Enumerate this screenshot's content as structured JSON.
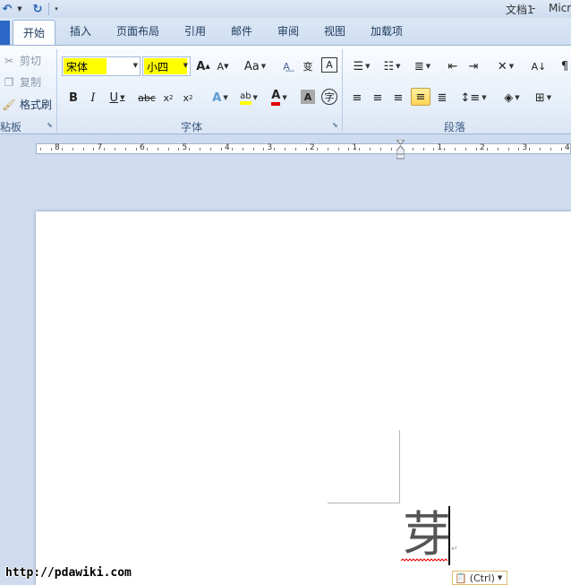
{
  "titlebar": {
    "doc_name": "文档1",
    "separator": " - ",
    "app_name": "Micr"
  },
  "qat": {
    "undo_icon": "undo-icon",
    "redo_icon": "redo-icon"
  },
  "tabs": {
    "home": "开始",
    "insert": "插入",
    "page_layout": "页面布局",
    "references": "引用",
    "mailings": "邮件",
    "review": "审阅",
    "view": "视图",
    "addins": "加载项"
  },
  "clipboard": {
    "cut": "剪切",
    "copy": "复制",
    "format_painter": "格式刷",
    "group_label": "粘板"
  },
  "font": {
    "family": "宋体",
    "size": "小四",
    "group_label": "字体"
  },
  "paragraph": {
    "group_label": "段落"
  },
  "ruler": {
    "left_numbers": [
      "8",
      "7",
      "6",
      "5",
      "4",
      "3",
      "2",
      "1"
    ],
    "right_numbers": [
      "1",
      "2",
      "3",
      "4"
    ]
  },
  "document": {
    "text": "芽",
    "para_mark": "↵"
  },
  "paste_options": {
    "label": "(Ctrl)"
  },
  "watermark": "http://pdawiki.com"
}
